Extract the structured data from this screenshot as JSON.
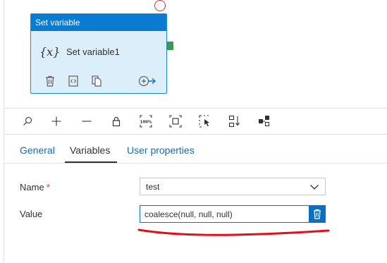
{
  "activity": {
    "header": "Set variable",
    "icon": "{x}",
    "name": "Set variable1"
  },
  "toolbar": {
    "zoom100_label": "100%",
    "icons": [
      "search-icon",
      "plus-icon",
      "minus-icon",
      "lock-icon",
      "zoom-100-icon",
      "fit-to-screen-icon",
      "select-cursor-icon",
      "auto-align-icon",
      "layout-icon"
    ]
  },
  "tabs": [
    {
      "label": "General"
    },
    {
      "label": "Variables"
    },
    {
      "label": "User properties"
    }
  ],
  "form": {
    "name_label": "Name",
    "required_mark": "*",
    "name_value": "test",
    "value_label": "Value",
    "value_text": "coalesce(null, null, null)"
  },
  "colors": {
    "accent": "#0b6fc0",
    "header": "#0b7ad1",
    "node_bg": "#ddeefb",
    "port": "#3b9b49",
    "annotation": "#e0101a"
  }
}
